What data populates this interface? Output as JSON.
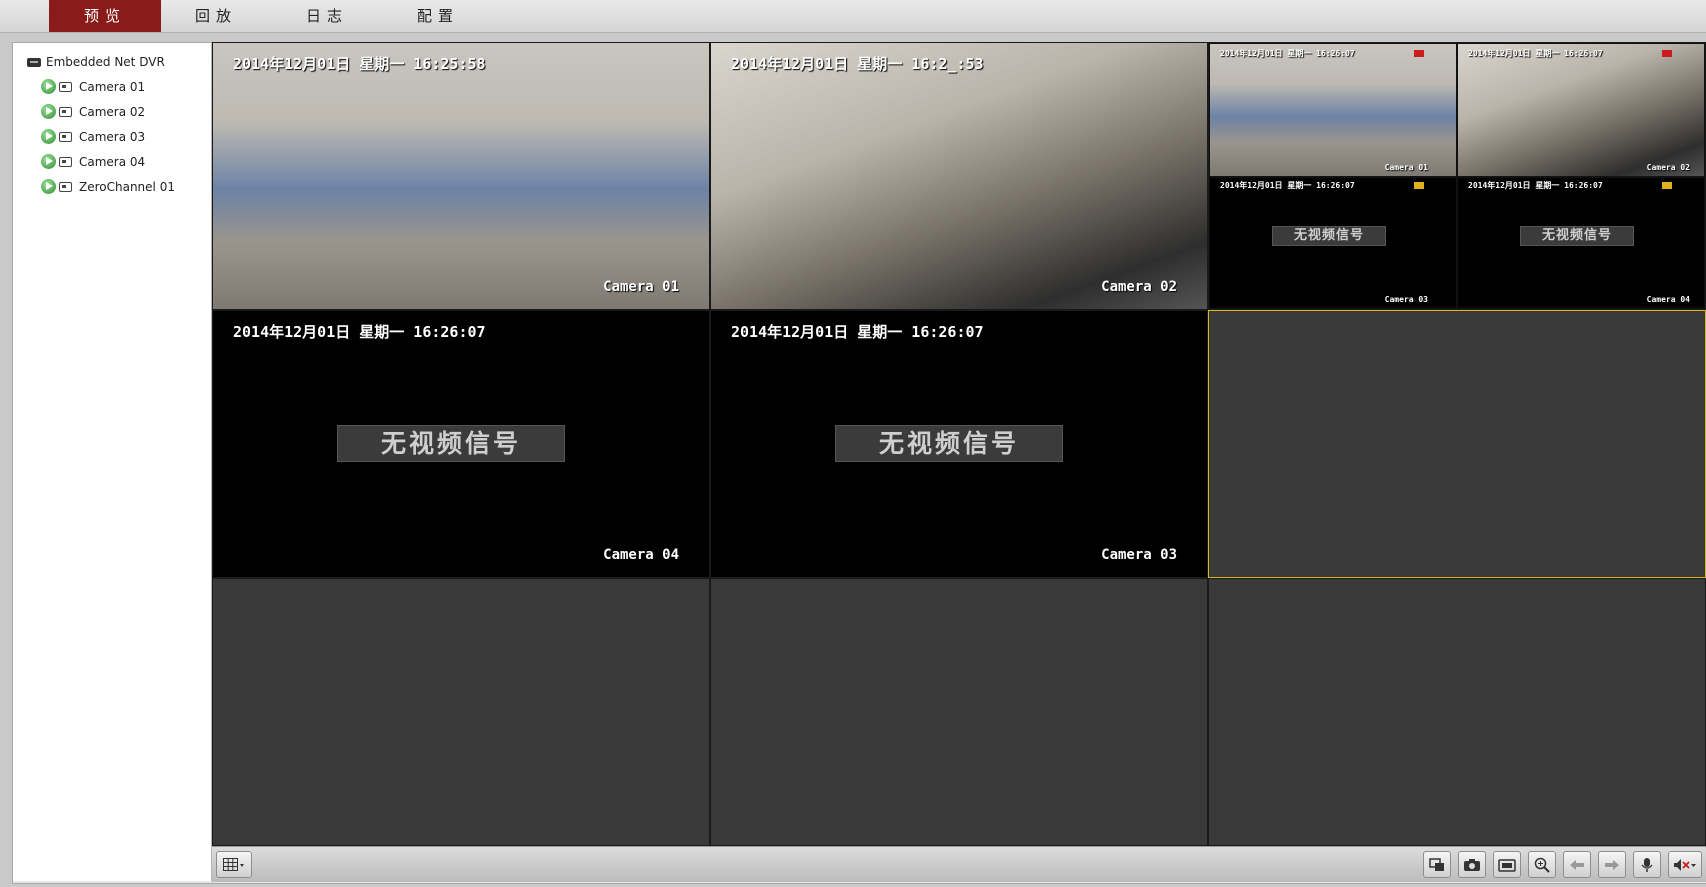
{
  "nav": {
    "tabs": [
      {
        "label": "预览",
        "active": true
      },
      {
        "label": "回放"
      },
      {
        "label": "日志"
      },
      {
        "label": "配置"
      }
    ]
  },
  "sidebar": {
    "root_label": "Embedded Net DVR",
    "items": [
      {
        "label": "Camera 01"
      },
      {
        "label": "Camera 02"
      },
      {
        "label": "Camera 03"
      },
      {
        "label": "Camera 04"
      },
      {
        "label": "ZeroChannel 01"
      }
    ]
  },
  "grid": {
    "cell1": {
      "timestamp": "2014年12月01日 星期一 16:25:58",
      "camera": "Camera 01"
    },
    "cell2": {
      "timestamp": "2014年12月01日 星期一 16:2_:53",
      "camera": "Camera 02"
    },
    "cell3": {
      "sub": [
        {
          "timestamp": "2014年12月01日 星期一 16:26:07",
          "camera": "Camera 01"
        },
        {
          "timestamp": "2014年12月01日 星期一 16:26:07",
          "camera": "Camera 02"
        },
        {
          "timestamp": "2014年12月01日 星期一 16:26:07",
          "camera": "Camera 03",
          "no_signal": "无视频信号"
        },
        {
          "timestamp": "2014年12月01日 星期一 16:26:07",
          "camera": "Camera 04",
          "no_signal": "无视频信号"
        }
      ]
    },
    "cell4": {
      "timestamp": "2014年12月01日 星期一 16:26:07",
      "camera": "Camera 04",
      "no_signal": "无视频信号"
    },
    "cell5": {
      "timestamp": "2014年12月01日 星期一 16:26:07",
      "camera": "Camera 03",
      "no_signal": "无视频信号"
    },
    "selected_border_color": "#d7b52a"
  },
  "toolbar": {
    "layout_icon": "grid-layout-icon",
    "right_icons": [
      "window-mode-icon",
      "camera-snapshot-icon",
      "record-icon",
      "zoom-in-icon",
      "prev-page-icon",
      "next-page-icon",
      "microphone-icon",
      "volume-mute-icon"
    ]
  },
  "colors": {
    "active_tab": "#8b1a1a",
    "grid_background": "#393939",
    "no_signal_background": "#000000"
  }
}
